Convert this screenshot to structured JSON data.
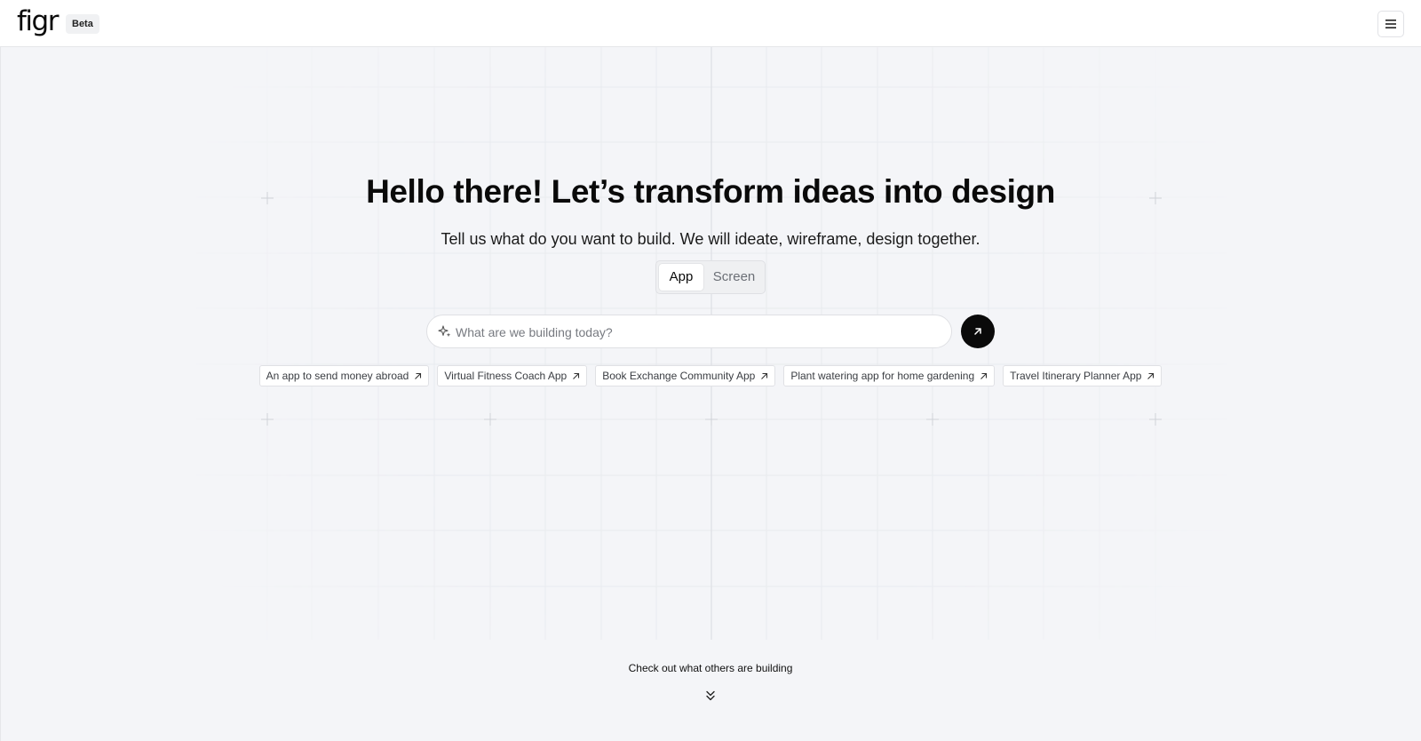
{
  "header": {
    "logo_text": "figr",
    "badge": "Beta",
    "menu_icon": "menu-icon"
  },
  "hero": {
    "title": "Hello there! Let’s transform ideas into design",
    "subtitle": "Tell us what do you want to build. We will ideate, wireframe, design together."
  },
  "mode_toggle": {
    "options": [
      "App",
      "Screen"
    ],
    "selected": "App"
  },
  "prompt": {
    "placeholder": "What are we building today?",
    "value": "",
    "leading_icon": "sparkle-icon",
    "submit_icon": "arrow-up-right-icon"
  },
  "suggestions": [
    "An app to send money abroad",
    "Virtual Fitness Coach App",
    "Book Exchange Community App",
    "Plant watering app for home gardening",
    "Travel Itinerary Planner App"
  ],
  "explore": {
    "label": "Check out what others are building",
    "icon": "chevrons-down-icon"
  },
  "colors": {
    "background": "#f4f5f8",
    "surface": "#ffffff",
    "primary": "#0a0a0a",
    "border": "#e0e1e5"
  }
}
